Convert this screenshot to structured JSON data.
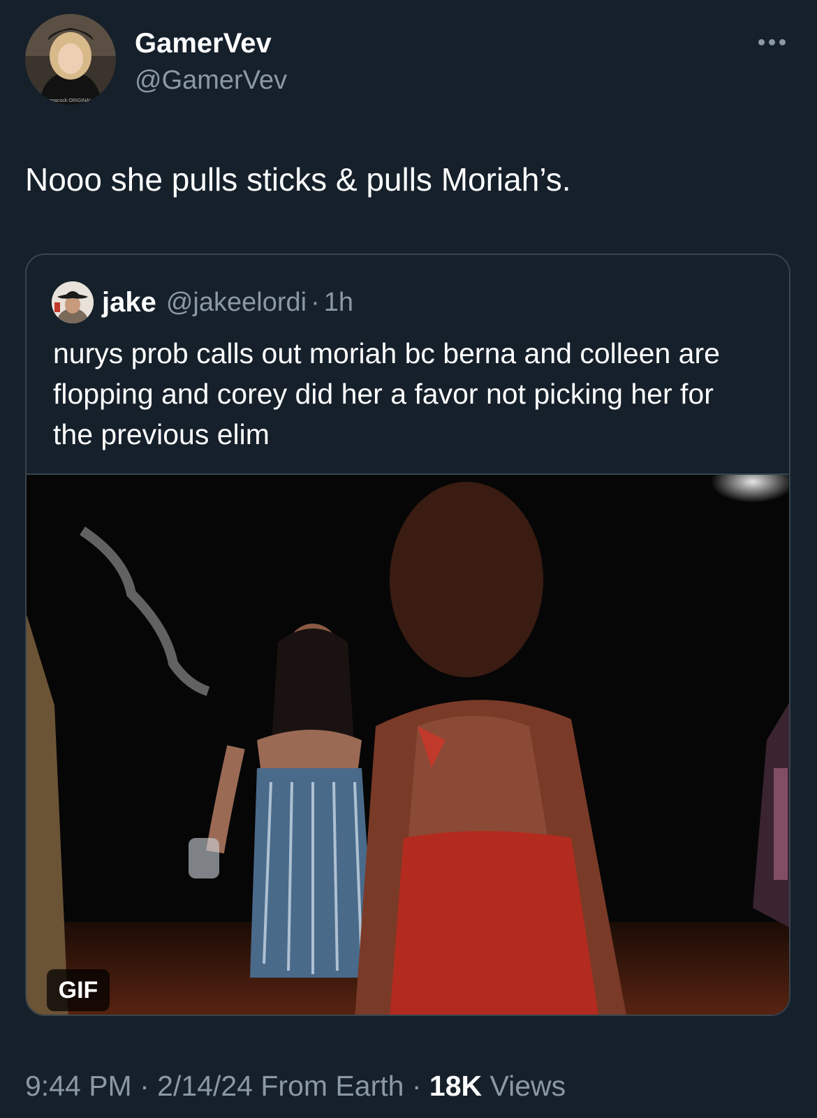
{
  "tweet": {
    "author": {
      "display_name": "GamerVev",
      "handle": "@GamerVev",
      "avatar_icon": "profile-photo-woman-blonde-beret"
    },
    "more_icon": "more-horizontal-icon",
    "text": "Nooo she pulls sticks & pulls Moriah’s.",
    "quoted_tweet": {
      "display_name": "jake",
      "handle": "@jakeelordi",
      "separator": "·",
      "time": "1h",
      "avatar_icon": "profile-photo-man-cowboy-hat",
      "text": "nurys prob calls out moriah bc berna and colleen are flopping and corey did her a favor not picking her for the previous elim",
      "media": {
        "type": "gif",
        "badge_label": "GIF"
      }
    },
    "meta": {
      "time": "9:44 PM",
      "separator": "·",
      "date": "2/14/24",
      "source": "From Earth",
      "views_count": "18K",
      "views_label": "Views"
    }
  },
  "colors": {
    "background": "#15202b",
    "border": "#38444d",
    "secondary_text": "#8b98a5",
    "primary_text": "#ffffff"
  }
}
